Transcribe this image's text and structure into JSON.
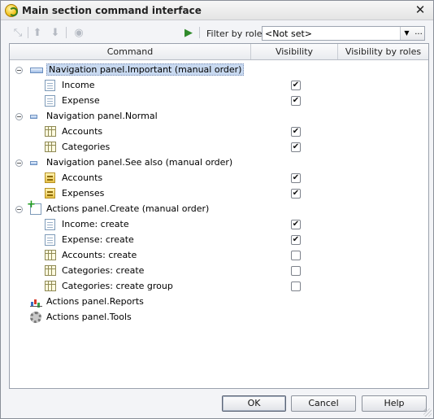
{
  "window": {
    "title": "Main section command interface",
    "close_glyph": "✕"
  },
  "toolbar": {
    "filter_label": "Filter by roles:",
    "filter_value": "<Not set>",
    "more_glyph": "..."
  },
  "columns": {
    "command": "Command",
    "visibility": "Visibility",
    "visibility_by_roles": "Visibility by roles"
  },
  "rows": [
    {
      "label": "Navigation panel.Important (manual order)",
      "icon": "panel-icon",
      "group": true,
      "selected": true
    },
    {
      "label": "Income",
      "icon": "document-icon",
      "checked": true
    },
    {
      "label": "Expense",
      "icon": "document-icon",
      "checked": true
    },
    {
      "label": "Navigation panel.Normal",
      "icon": "panel-small-icon",
      "group": true
    },
    {
      "label": "Accounts",
      "icon": "catalog-icon",
      "checked": true
    },
    {
      "label": "Categories",
      "icon": "catalog-icon",
      "checked": true
    },
    {
      "label": "Navigation panel.See also (manual order)",
      "icon": "panel-small-icon",
      "group": true
    },
    {
      "label": "Accounts",
      "icon": "register-icon",
      "checked": true
    },
    {
      "label": "Expenses",
      "icon": "register-icon",
      "checked": true
    },
    {
      "label": "Actions panel.Create (manual order)",
      "icon": "create-icon",
      "group": true
    },
    {
      "label": "Income: create",
      "icon": "document-icon",
      "checked": true
    },
    {
      "label": "Expense: create",
      "icon": "document-icon",
      "checked": true
    },
    {
      "label": "Accounts: create",
      "icon": "catalog-icon",
      "checked": false
    },
    {
      "label": "Categories: create",
      "icon": "catalog-icon",
      "checked": false
    },
    {
      "label": "Categories: create group",
      "icon": "catalog-icon",
      "checked": false
    },
    {
      "label": "Actions panel.Reports",
      "icon": "report-icon",
      "group": true
    },
    {
      "label": "Actions panel.Tools",
      "icon": "gear-icon",
      "group": true
    }
  ],
  "buttons": {
    "ok": "OK",
    "cancel": "Cancel",
    "help": "Help"
  }
}
